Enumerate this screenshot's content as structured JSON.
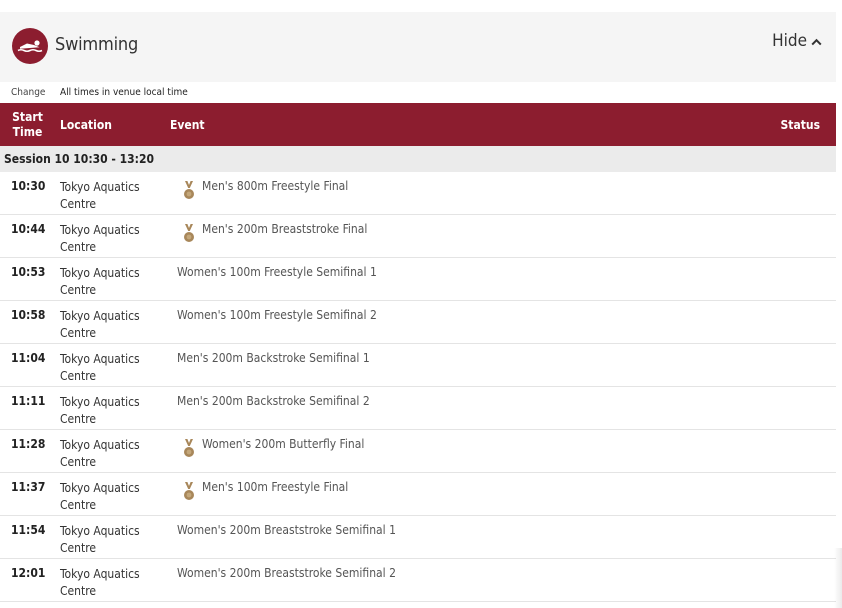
{
  "sport": {
    "title": "Swimming",
    "icon": "swimmer-icon",
    "hide_label": "Hide",
    "accent_color": "#8c1d2f"
  },
  "timezone": {
    "change_label": "Change",
    "note": "All times in venue local time"
  },
  "table": {
    "headers": {
      "start_line1": "Start",
      "start_line2": "Time",
      "location": "Location",
      "event": "Event",
      "status": "Status"
    },
    "session": "Session 10  10:30 - 13:20",
    "rows": [
      {
        "time": "10:30",
        "location_line1": "Tokyo Aquatics",
        "location_line2": "Centre",
        "event": "Men's 800m Freestyle Final",
        "medal": true,
        "status": ""
      },
      {
        "time": "10:44",
        "location_line1": "Tokyo Aquatics",
        "location_line2": "Centre",
        "event": "Men's 200m Breaststroke Final",
        "medal": true,
        "status": ""
      },
      {
        "time": "10:53",
        "location_line1": "Tokyo Aquatics",
        "location_line2": "Centre",
        "event": "Women's 100m Freestyle Semifinal 1",
        "medal": false,
        "status": ""
      },
      {
        "time": "10:58",
        "location_line1": "Tokyo Aquatics",
        "location_line2": "Centre",
        "event": "Women's 100m Freestyle Semifinal 2",
        "medal": false,
        "status": ""
      },
      {
        "time": "11:04",
        "location_line1": "Tokyo Aquatics",
        "location_line2": "Centre",
        "event": "Men's 200m Backstroke Semifinal 1",
        "medal": false,
        "status": ""
      },
      {
        "time": "11:11",
        "location_line1": "Tokyo Aquatics",
        "location_line2": "Centre",
        "event": "Men's 200m Backstroke Semifinal 2",
        "medal": false,
        "status": ""
      },
      {
        "time": "11:28",
        "location_line1": "Tokyo Aquatics",
        "location_line2": "Centre",
        "event": "Women's 200m Butterfly Final",
        "medal": true,
        "status": ""
      },
      {
        "time": "11:37",
        "location_line1": "Tokyo Aquatics",
        "location_line2": "Centre",
        "event": "Men's 100m Freestyle Final",
        "medal": true,
        "status": ""
      },
      {
        "time": "11:54",
        "location_line1": "Tokyo Aquatics",
        "location_line2": "Centre",
        "event": "Women's 200m Breaststroke Semifinal 1",
        "medal": false,
        "status": ""
      },
      {
        "time": "12:01",
        "location_line1": "Tokyo Aquatics",
        "location_line2": "Centre",
        "event": "Women's 200m Breaststroke Semifinal 2",
        "medal": false,
        "status": ""
      }
    ]
  },
  "icons": {
    "medal": "medal-icon",
    "chevron": "chevron-up-icon"
  },
  "colors": {
    "header_bg": "#8c1d2f",
    "session_bg": "#ebebeb",
    "medal_color": "#a8875a"
  }
}
